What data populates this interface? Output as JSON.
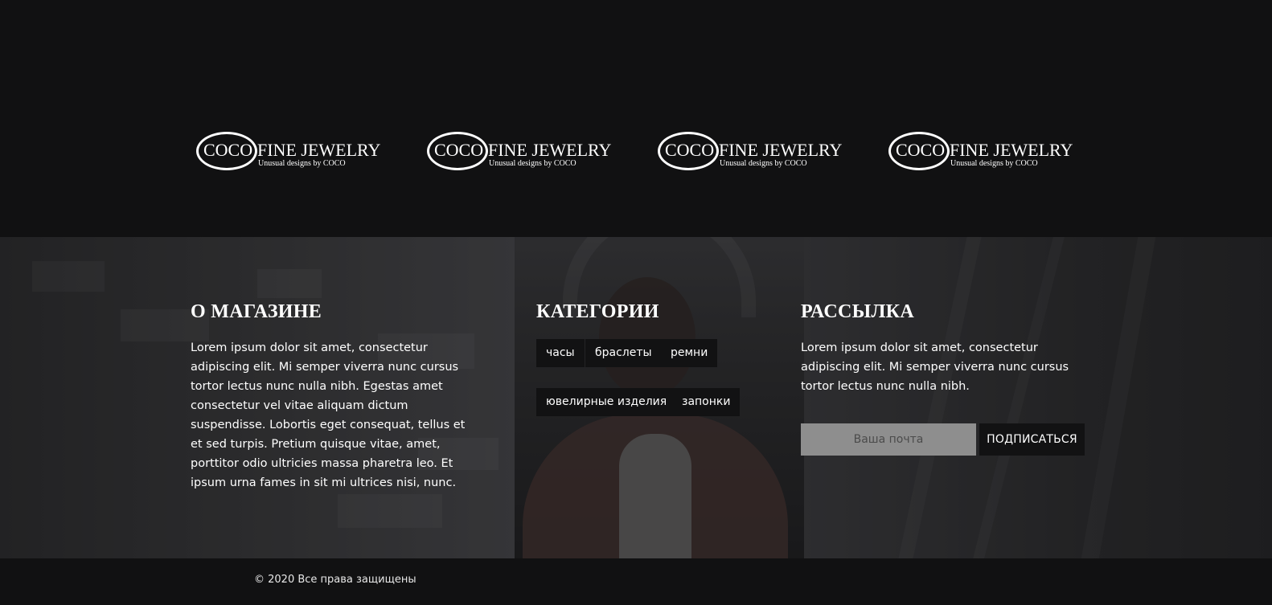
{
  "logos": [
    {
      "mark": "COCO",
      "name": "FINE JEWELRY",
      "tagline": "Unusual designs by COCO"
    },
    {
      "mark": "COCO",
      "name": "FINE JEWELRY",
      "tagline": "Unusual designs by COCO"
    },
    {
      "mark": "COCO",
      "name": "FINE JEWELRY",
      "tagline": "Unusual designs by COCO"
    },
    {
      "mark": "COCO",
      "name": "FINE JEWELRY",
      "tagline": "Unusual designs by COCO"
    }
  ],
  "about": {
    "title": "О МАГАЗИНЕ",
    "text": "Lorem ipsum dolor sit amet, consectetur adipiscing elit. Mi semper viverra nunc cursus tortor lectus nunc nulla nibh. Egestas amet consectetur vel vitae aliquam dictum suspendisse. Lobortis eget consequat, tellus et et sed turpis. Pretium quisque vitae, amet, porttitor odio ultricies massa pharetra leo. Et ipsum urna fames in sit mi ultrices nisi, nunc."
  },
  "categories": {
    "title": "КАТЕГОРИИ",
    "items": [
      "часы",
      "браслеты",
      "ремни",
      "ювелирные изделия",
      "запонки"
    ]
  },
  "newsletter": {
    "title": "РАССЫЛКА",
    "text": "Lorem ipsum dolor sit amet, consectetur adipiscing elit. Mi semper viverra nunc cursus tortor lectus nunc nulla nibh.",
    "email_placeholder": "Ваша почта",
    "subscribe_label": "ПОДПИСАТЬСЯ"
  },
  "footer": {
    "copyright": "© 2020 Все права защищены"
  },
  "colors": {
    "background": "#111112",
    "tag_background": "#121213",
    "input_background": "#8e8e8e"
  }
}
